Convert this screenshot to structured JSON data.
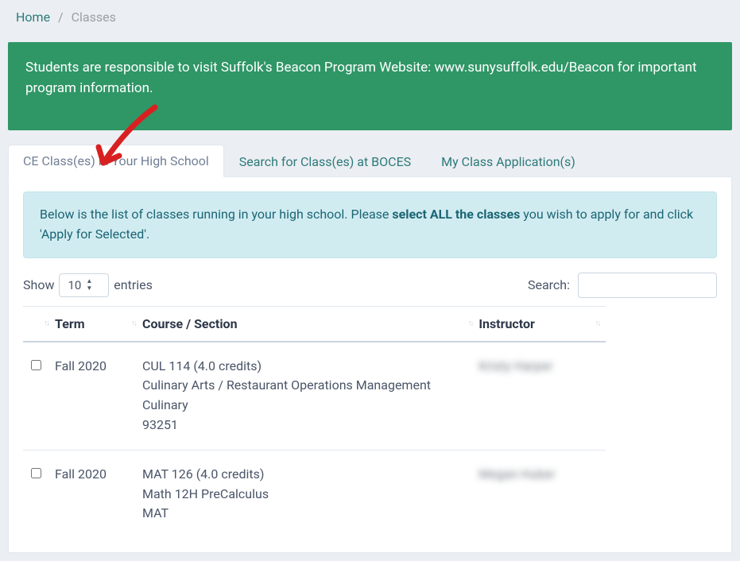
{
  "breadcrumb": {
    "home": "Home",
    "current": "Classes"
  },
  "banner": {
    "text": "Students are responsible to visit Suffolk's Beacon Program Website: www.sunysuffolk.edu/Beacon for important program information."
  },
  "tabs": {
    "tab1": "CE Class(es) in Your High School",
    "tab2": "Search for Class(es) at BOCES",
    "tab3": "My Class Application(s)"
  },
  "info": {
    "pre": "Below is the list of classes running in your high school. Please ",
    "bold": "select ALL the classes",
    "post": " you wish to apply for and click 'Apply for Selected'."
  },
  "controls": {
    "show_label": "Show",
    "show_value": "10",
    "entries_label": "entries",
    "search_label": "Search:"
  },
  "headers": {
    "term": "Term",
    "course": "Course / Section",
    "instructor": "Instructor"
  },
  "rows": [
    {
      "term": "Fall 2020",
      "course_title": "CUL 114 (4.0 credits)",
      "course_line2": "Culinary Arts / Restaurant Operations Management",
      "course_line3": "Culinary",
      "course_line4": "93251",
      "instructor": "Kristy Harper"
    },
    {
      "term": "Fall 2020",
      "course_title": "MAT 126 (4.0 credits)",
      "course_line2": "Math 12H PreCalculus",
      "course_line3": "MAT",
      "course_line4": "",
      "instructor": "Megan Huber"
    }
  ]
}
